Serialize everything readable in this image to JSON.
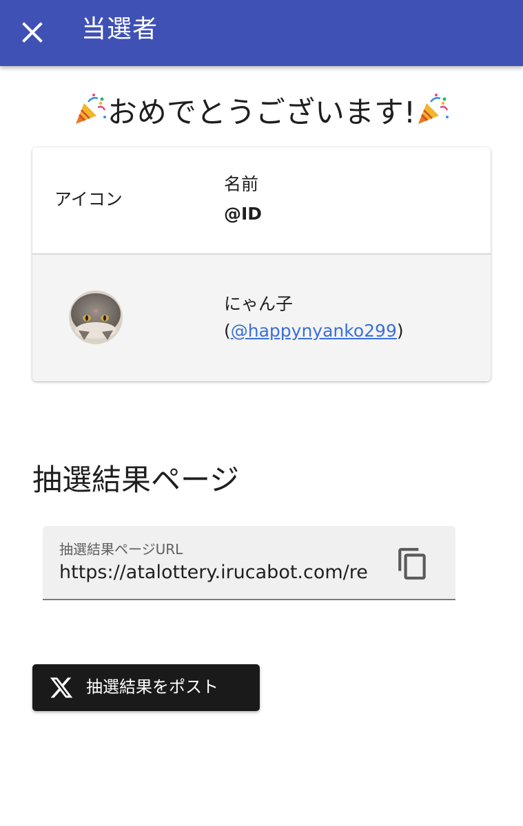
{
  "appbar": {
    "title": "当選者",
    "close_icon": "close-icon",
    "background": "#3f51b5"
  },
  "congrats": {
    "text": "おめでとうございます!",
    "emoji": "party-popper-icon"
  },
  "winner_table": {
    "headers": {
      "icon": "アイコン",
      "name": "名前",
      "id": "@ID"
    },
    "rows": [
      {
        "avatar": "cat-avatar",
        "name": "にゃん子",
        "id_prefix": "(",
        "id": "@happynyanko299",
        "id_suffix": ")"
      }
    ]
  },
  "result_section": {
    "title": "抽選結果ページ",
    "url_field": {
      "label": "抽選結果ページURL",
      "value": "https://atalottery.irucabot.com/re",
      "copy_icon": "copy-icon"
    }
  },
  "post_button": {
    "label": "抽選結果をポスト",
    "icon": "x-logo-icon"
  },
  "colors": {
    "accent": "#3f51b5",
    "link": "#3a6fd8",
    "button_dark": "#1a1a1a"
  }
}
